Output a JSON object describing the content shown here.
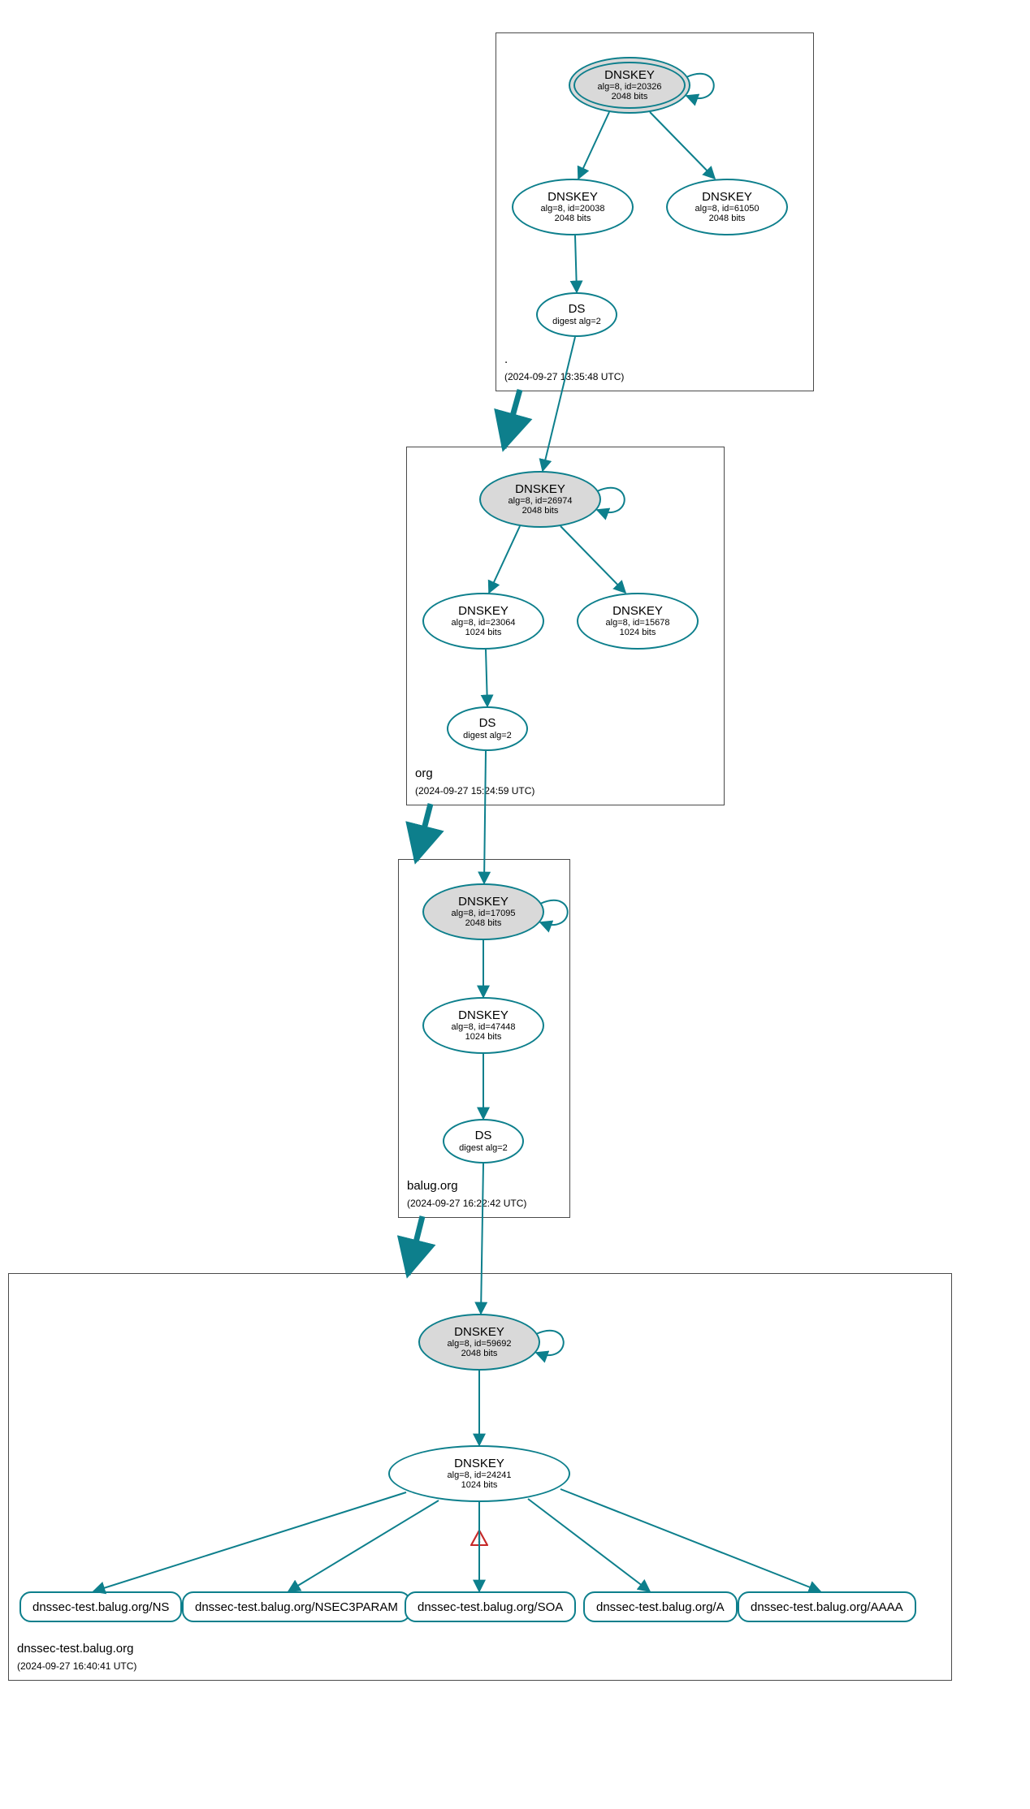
{
  "zones": {
    "root": {
      "label": ".",
      "timestamp": "(2024-09-27 13:35:48 UTC)",
      "nodes": {
        "ksk": {
          "title": "DNSKEY",
          "sub1": "alg=8, id=20326",
          "sub2": "2048 bits"
        },
        "zsk1": {
          "title": "DNSKEY",
          "sub1": "alg=8, id=20038",
          "sub2": "2048 bits"
        },
        "zsk2": {
          "title": "DNSKEY",
          "sub1": "alg=8, id=61050",
          "sub2": "2048 bits"
        },
        "ds": {
          "title": "DS",
          "sub1": "digest alg=2",
          "sub2": ""
        }
      }
    },
    "org": {
      "label": "org",
      "timestamp": "(2024-09-27 15:24:59 UTC)",
      "nodes": {
        "ksk": {
          "title": "DNSKEY",
          "sub1": "alg=8, id=26974",
          "sub2": "2048 bits"
        },
        "zsk1": {
          "title": "DNSKEY",
          "sub1": "alg=8, id=23064",
          "sub2": "1024 bits"
        },
        "zsk2": {
          "title": "DNSKEY",
          "sub1": "alg=8, id=15678",
          "sub2": "1024 bits"
        },
        "ds": {
          "title": "DS",
          "sub1": "digest alg=2",
          "sub2": ""
        }
      }
    },
    "balug": {
      "label": "balug.org",
      "timestamp": "(2024-09-27 16:22:42 UTC)",
      "nodes": {
        "ksk": {
          "title": "DNSKEY",
          "sub1": "alg=8, id=17095",
          "sub2": "2048 bits"
        },
        "zsk": {
          "title": "DNSKEY",
          "sub1": "alg=8, id=47448",
          "sub2": "1024 bits"
        },
        "ds": {
          "title": "DS",
          "sub1": "digest alg=2",
          "sub2": ""
        }
      }
    },
    "dnssectest": {
      "label": "dnssec-test.balug.org",
      "timestamp": "(2024-09-27 16:40:41 UTC)",
      "nodes": {
        "ksk": {
          "title": "DNSKEY",
          "sub1": "alg=8, id=59692",
          "sub2": "2048 bits"
        },
        "zsk": {
          "title": "DNSKEY",
          "sub1": "alg=8, id=24241",
          "sub2": "1024 bits"
        }
      },
      "rrsets": {
        "ns": "dnssec-test.balug.org/NS",
        "nsec3p": "dnssec-test.balug.org/NSEC3PARAM",
        "soa": "dnssec-test.balug.org/SOA",
        "a": "dnssec-test.balug.org/A",
        "aaaa": "dnssec-test.balug.org/AAAA"
      }
    }
  },
  "colors": {
    "stroke": "#0d7f8c"
  }
}
